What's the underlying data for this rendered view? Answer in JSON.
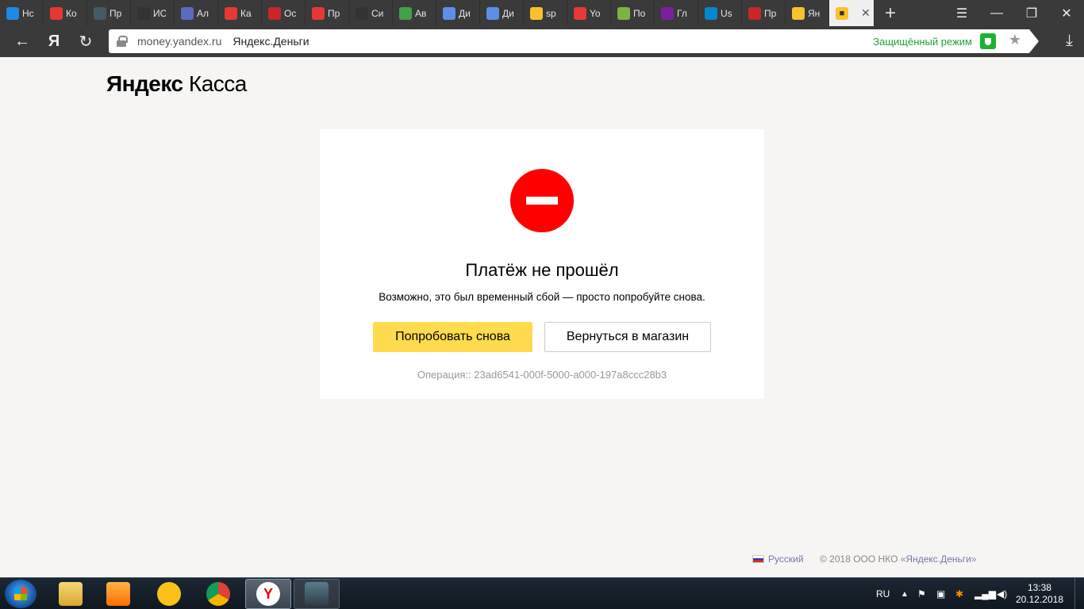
{
  "browser": {
    "tabs": [
      {
        "label": "Нс",
        "icon": "at-icon",
        "color": "#1e88e5"
      },
      {
        "label": "Ко",
        "icon": "palette-icon",
        "color": "#e53935"
      },
      {
        "label": "Пр",
        "icon": "monitor-icon",
        "color": "#455a64"
      },
      {
        "label": "ИС",
        "icon": "book-icon",
        "color": "#333333"
      },
      {
        "label": "Ал",
        "icon": "shield-icon",
        "color": "#5c6bc0"
      },
      {
        "label": "Ка",
        "icon": "drop-icon",
        "color": "#e53935"
      },
      {
        "label": "Ос",
        "icon": "emblem-icon",
        "color": "#c62828"
      },
      {
        "label": "Пр",
        "icon": "c-icon",
        "color": "#e53935"
      },
      {
        "label": "Си",
        "icon": "star-outline-icon",
        "color": "#333333"
      },
      {
        "label": "Ав",
        "icon": "check-icon",
        "color": "#43a047"
      },
      {
        "label": "Ди",
        "icon": "chat-icon",
        "color": "#5c8fe6"
      },
      {
        "label": "Ди",
        "icon": "chat-icon",
        "color": "#5c8fe6"
      },
      {
        "label": "sp",
        "icon": "sun-icon",
        "color": "#fbc02d"
      },
      {
        "label": "Yo",
        "icon": "play-icon",
        "color": "#e53935"
      },
      {
        "label": "По",
        "icon": "two-icon",
        "color": "#7cb342"
      },
      {
        "label": "Гл",
        "icon": "person-icon",
        "color": "#7b1fa2"
      },
      {
        "label": "Us",
        "icon": "u-icon",
        "color": "#0288d1"
      },
      {
        "label": "Пр",
        "icon": "power-icon",
        "color": "#c62828"
      },
      {
        "label": "Ян",
        "icon": "wallet-icon",
        "color": "#fbc02d"
      }
    ],
    "active_tab": {
      "icon": "wallet-icon",
      "color": "#fbc02d"
    },
    "new_tab_glyph": "+",
    "url_domain": "money.yandex.ru",
    "url_title": "Яндекс.Деньги",
    "protect_label": "Защищённый режим",
    "yandex_glyph": "Я"
  },
  "page": {
    "logo_bold": "Яндекс",
    "logo_regular": "Касса",
    "error": {
      "title": "Платёж не прошёл",
      "subtitle": "Возможно, это был временный сбой — просто попробуйте снова.",
      "retry_label": "Попробовать снова",
      "back_label": "Вернуться в магазин",
      "operation": "Операция:: 23ad6541-000f-5000-a000-197a8ccc28b3"
    },
    "footer": {
      "language": "Русский",
      "copyright_prefix": "© 2018 ООО НКО «",
      "copyright_link": "Яндекс.Деньги",
      "copyright_suffix": "»"
    }
  },
  "taskbar": {
    "lang": "RU",
    "time": "13:38",
    "date": "20.12.2018"
  },
  "colors": {
    "accent_yellow": "#ffdb4d",
    "error_red": "#ff0000",
    "protect_green": "#22a03c"
  }
}
